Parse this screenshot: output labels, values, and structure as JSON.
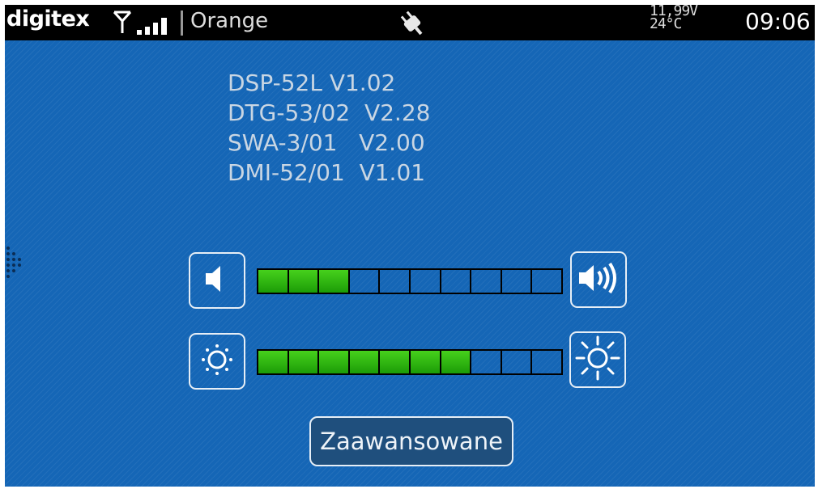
{
  "status_bar": {
    "brand": "digitex",
    "carrier": "Orange",
    "voltage": "11,99V",
    "temperature": "24°C",
    "time": "09:06",
    "signal_level": 4,
    "icons": [
      "antenna-icon",
      "signal-strength-icon",
      "power-plug-icon"
    ]
  },
  "versions": [
    "DSP-52L V1.02",
    "DTG-53/02  V2.28",
    "SWA-3/01   V2.00",
    "DMI-52/01  V1.01"
  ],
  "volume": {
    "level": 3,
    "segments": 10,
    "decrease_icon": "speaker-low-icon",
    "increase_icon": "speaker-high-icon"
  },
  "brightness": {
    "level": 7,
    "segments": 10,
    "decrease_icon": "sun-dim-icon",
    "increase_icon": "sun-bright-icon"
  },
  "advanced_button": {
    "label": "Zaawansowane"
  },
  "colors": {
    "background": "#1566b6",
    "status_bar": "#000000",
    "bar_fill": "#2fb80f",
    "button_border": "#e6eef6"
  }
}
